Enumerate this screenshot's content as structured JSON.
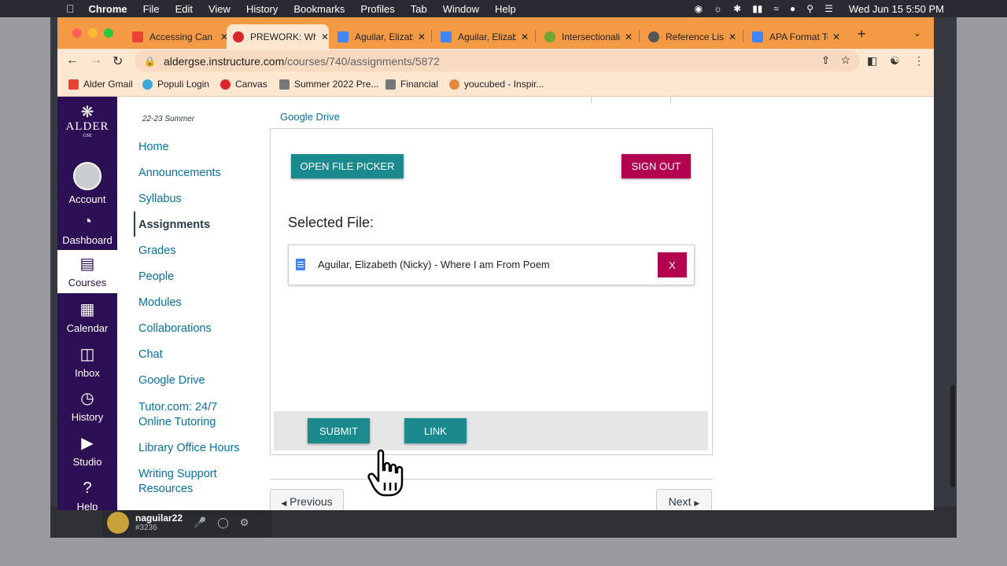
{
  "menubar": {
    "app": "Chrome",
    "items": [
      "File",
      "Edit",
      "View",
      "History",
      "Bookmarks",
      "Profiles",
      "Tab",
      "Window",
      "Help"
    ],
    "clock": "Wed Jun 15  5:50 PM"
  },
  "tabs": [
    {
      "title": "Accessing Can",
      "favicon_color": "#ea4335"
    },
    {
      "title": "PREWORK: Wh",
      "favicon_color": "#d9262c"
    },
    {
      "title": "Aguilar, Elizab",
      "favicon_color": "#4285f4"
    },
    {
      "title": "Aguilar, Elizab",
      "favicon_color": "#4285f4"
    },
    {
      "title": "Intersectionali",
      "favicon_color": "#6fa632"
    },
    {
      "title": "Reference List",
      "favicon_color": "#555555"
    },
    {
      "title": "APA Format Te",
      "favicon_color": "#4285f4"
    }
  ],
  "address": {
    "host": "aldergse.instructure.com",
    "path": "/courses/740/assignments/5872"
  },
  "bookmarks": [
    {
      "label": "Alder Gmail",
      "color": "#ea4335"
    },
    {
      "label": "Populi Login",
      "color": "#3ba9d9"
    },
    {
      "label": "Canvas",
      "color": "#d9262c"
    },
    {
      "label": "Summer 2022 Pre...",
      "color": "#777777"
    },
    {
      "label": "Financial",
      "color": "#777777"
    },
    {
      "label": "youcubed - Inspir...",
      "color": "#e08a3c"
    }
  ],
  "global_nav": {
    "logo_word": "ALDER",
    "logo_sub": "GSE",
    "items": [
      "Account",
      "Dashboard",
      "Courses",
      "Calendar",
      "Inbox",
      "History",
      "Studio",
      "Help"
    ]
  },
  "course_nav": {
    "term": "22-23 Summer",
    "items": [
      "Home",
      "Announcements",
      "Syllabus",
      "Assignments",
      "Grades",
      "People",
      "Modules",
      "Collaborations",
      "Chat",
      "Google Drive",
      "Tutor.com: 24/7",
      "Online Tutoring",
      "Library Office Hours",
      "Writing Support",
      "Resources"
    ]
  },
  "content": {
    "section_label": "Google Drive",
    "open_picker": "OPEN FILE PICKER",
    "sign_out": "SIGN OUT",
    "selected_label": "Selected File:",
    "file_name": "Aguilar, Elizabeth (Nicky) - Where I am From Poem",
    "remove": "X",
    "submit": "SUBMIT",
    "link": "LINK",
    "previous": "Previous",
    "next": "Next"
  },
  "discord": {
    "username": "naguilar22",
    "tag": "#3236"
  }
}
